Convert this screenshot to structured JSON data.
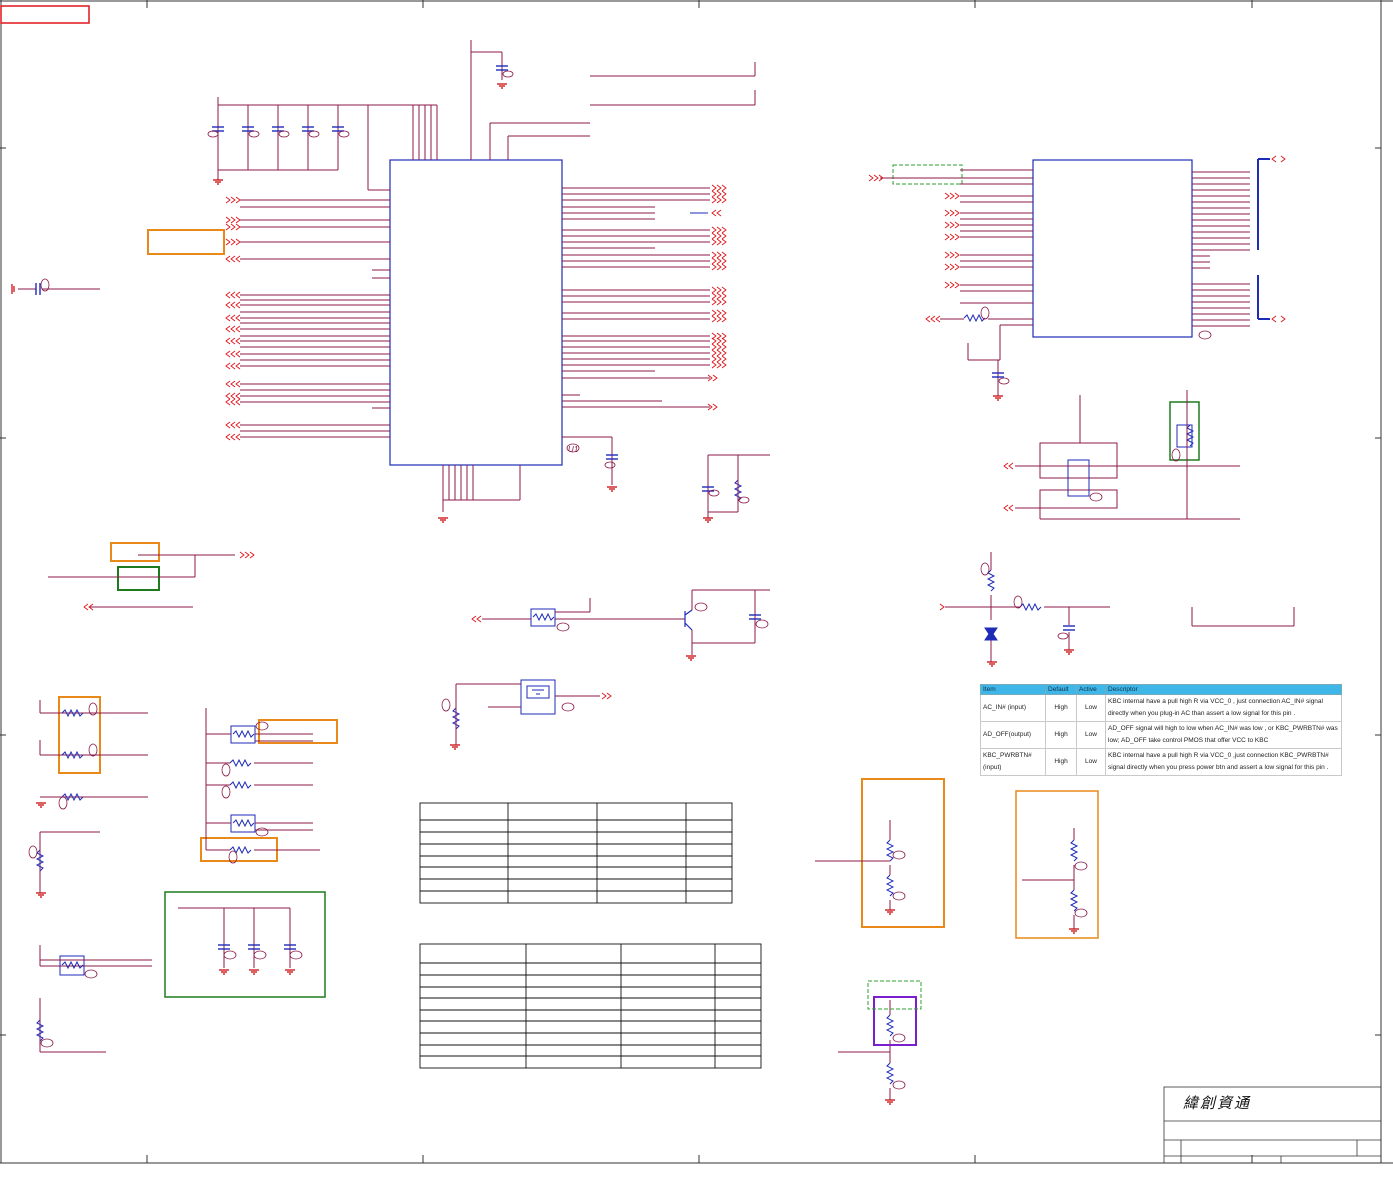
{
  "kbc_table": {
    "headers": [
      "Item",
      "Default",
      "Active",
      "Descriptor"
    ],
    "rows": [
      {
        "item": "AC_IN# (input)",
        "default": "High",
        "active": "Low",
        "desc_lines": [
          "KBC internal have a pull high R via VCC_0 , just connection AC_IN# signal",
          "directly when you plug-in AC than assert a low signal for this pin ."
        ]
      },
      {
        "item": "AD_OFF(output)",
        "default": "High",
        "active": "Low",
        "desc_lines": [
          "AD_OFF signal will high to low when AC_IN# was low , or KBC_PWRBTN# was",
          "low; AD_OFF take control PMOS that offer VCC to KBC"
        ]
      },
      {
        "item_lines": [
          "KBC_PWRBTN#",
          "(input)"
        ],
        "default": "High",
        "active": "Low",
        "desc_lines": [
          "KBC internal have a pull high R via VCC_0 ,just connection KBC_PWRBTN#",
          "signal directly when you press power btn and assert a low signal for this pin ."
        ]
      }
    ]
  },
  "title_block": {
    "company": "緯創資通"
  },
  "colors": {
    "wire": "#8b1a4a",
    "bus": "#1e2bb8",
    "ground": "#cc0000",
    "component": "#1e2bb8",
    "highlight_orange": "#e8891a",
    "highlight_green": "#1f7a1f",
    "highlight_red": "#e0151b",
    "highlight_purple": "#7a1fcc",
    "table_header": "#3fb6e8"
  }
}
